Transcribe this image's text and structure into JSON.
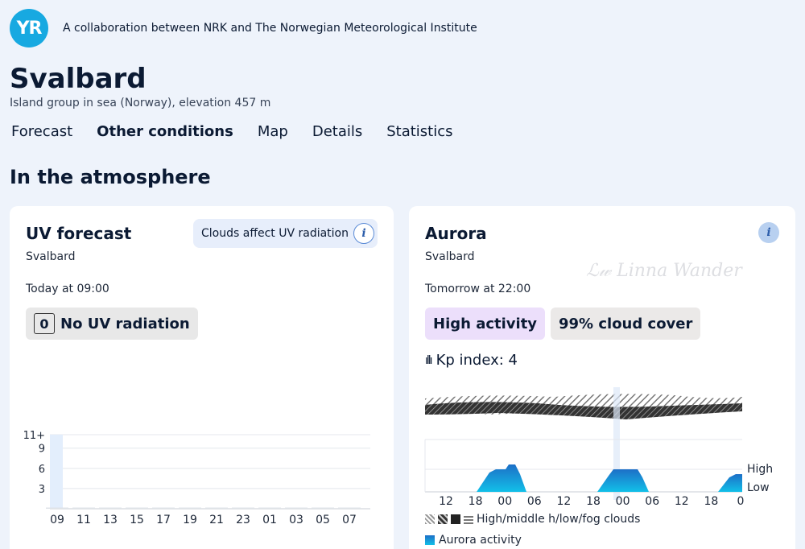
{
  "header": {
    "logo": "YR",
    "collab": "A collaboration between NRK and The Norwegian Meteorological Institute"
  },
  "location": {
    "title": "Svalbard",
    "subtitle": "Island group in sea (Norway), elevation 457 m"
  },
  "nav": [
    {
      "label": "Forecast",
      "active": false
    },
    {
      "label": "Other conditions",
      "active": true
    },
    {
      "label": "Map",
      "active": false
    },
    {
      "label": "Details",
      "active": false
    },
    {
      "label": "Statistics",
      "active": false
    }
  ],
  "section_title": "In the atmosphere",
  "uv": {
    "title": "UV forecast",
    "info_label": "Clouds affect UV radiation",
    "location": "Svalbard",
    "time": "Today at 09:00",
    "value": "0",
    "label": "No UV radiation",
    "y_ticks": [
      "11+",
      "9",
      "6",
      "3"
    ],
    "x_ticks": [
      "09",
      "11",
      "13",
      "15",
      "17",
      "19",
      "21",
      "23",
      "01",
      "03",
      "05",
      "07"
    ]
  },
  "aurora": {
    "title": "Aurora",
    "location": "Svalbard",
    "time": "Tomorrow at 22:00",
    "activity": "High activity",
    "cloud": "99% cloud cover",
    "kp": "Kp index: 4",
    "x_ticks": [
      "12",
      "18",
      "00",
      "06",
      "12",
      "18",
      "00",
      "06",
      "12",
      "18",
      "0"
    ],
    "level_high": "High",
    "level_low": "Low",
    "legend_clouds": "High/middle h/low/fog clouds",
    "legend_aurora": "Aurora activity",
    "watermark": "Linna Wander"
  },
  "colors": {
    "accent": "#17a9e1",
    "aurora": "#1aa9e0"
  },
  "chart_data": [
    {
      "type": "bar",
      "categories": [
        "09",
        "11",
        "13",
        "15",
        "17",
        "19",
        "21",
        "23",
        "01",
        "03",
        "05",
        "07"
      ],
      "values": [
        0,
        0,
        0,
        0,
        0,
        0,
        0,
        0,
        0,
        0,
        0,
        0
      ],
      "ylim": [
        0,
        11
      ],
      "grid": true
    }
  ]
}
